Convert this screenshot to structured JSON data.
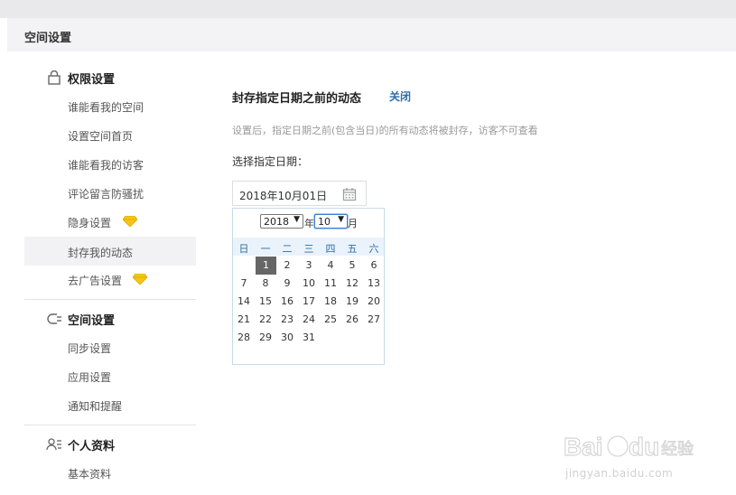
{
  "header": {
    "title": "空间设置"
  },
  "sidebar": {
    "sections": [
      {
        "label": "权限设置",
        "icon": "lock-icon",
        "items": [
          {
            "label": "谁能看我的空间"
          },
          {
            "label": "设置空间首页"
          },
          {
            "label": "谁能看我的访客"
          },
          {
            "label": "评论留言防骚扰"
          },
          {
            "label": "隐身设置",
            "badge": "diamond-icon"
          },
          {
            "label": "封存我的动态",
            "active": true
          },
          {
            "label": "去广告设置",
            "badge": "diamond-icon"
          }
        ]
      },
      {
        "label": "空间设置",
        "icon": "plug-icon",
        "items": [
          {
            "label": "同步设置"
          },
          {
            "label": "应用设置"
          },
          {
            "label": "通知和提醒"
          }
        ]
      },
      {
        "label": "个人资料",
        "icon": "profile-icon",
        "items": [
          {
            "label": "基本资料"
          }
        ]
      }
    ]
  },
  "main": {
    "title": "封存指定日期之前的动态",
    "close_label": "关闭",
    "hint": "设置后，指定日期之前(包含当日)的所有动态将被封存，访客不可查看",
    "date_label": "选择指定日期：",
    "date_value": "2018年10月01日"
  },
  "calendar": {
    "year": "2018",
    "year_suffix": "年",
    "month": "10",
    "month_suffix": "月",
    "weekdays": [
      "日",
      "一",
      "二",
      "三",
      "四",
      "五",
      "六"
    ],
    "first_weekday": 1,
    "days_in_month": 31,
    "selected_day": 1
  },
  "watermark": {
    "text": "jingyan.baidu.com",
    "logo": "Baidu 经验"
  },
  "colors": {
    "link": "#2f6ea6",
    "weekday_bg": "#eaf3fb",
    "selected_day": "#666666",
    "gem": "#f5c518"
  }
}
